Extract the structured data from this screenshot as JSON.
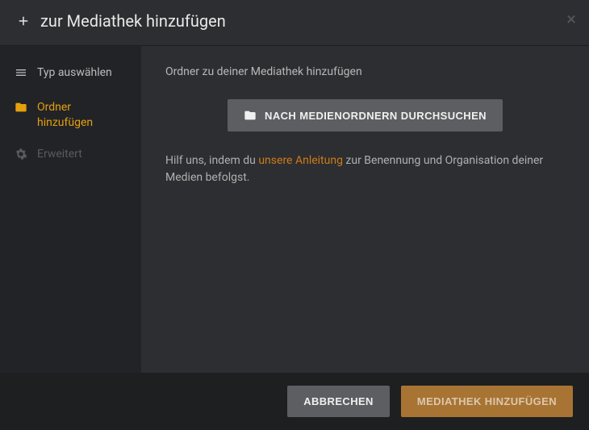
{
  "header": {
    "title": "zur Mediathek hinzufügen"
  },
  "sidebar": {
    "items": [
      {
        "label": "Typ auswählen"
      },
      {
        "label": "Ordner hinzufügen"
      },
      {
        "label": "Erweitert"
      }
    ]
  },
  "content": {
    "instruction": "Ordner zu deiner Mediathek hinzufügen",
    "browse_label": "NACH MEDIENORDNERN DURCHSUCHEN",
    "help_pre": "Hilf uns, indem du ",
    "help_link": "unsere Anleitung",
    "help_post": " zur Benennung und Organisation deiner Medien befolgst."
  },
  "footer": {
    "cancel": "ABBRECHEN",
    "submit": "MEDIATHEK HINZUFÜGEN"
  }
}
